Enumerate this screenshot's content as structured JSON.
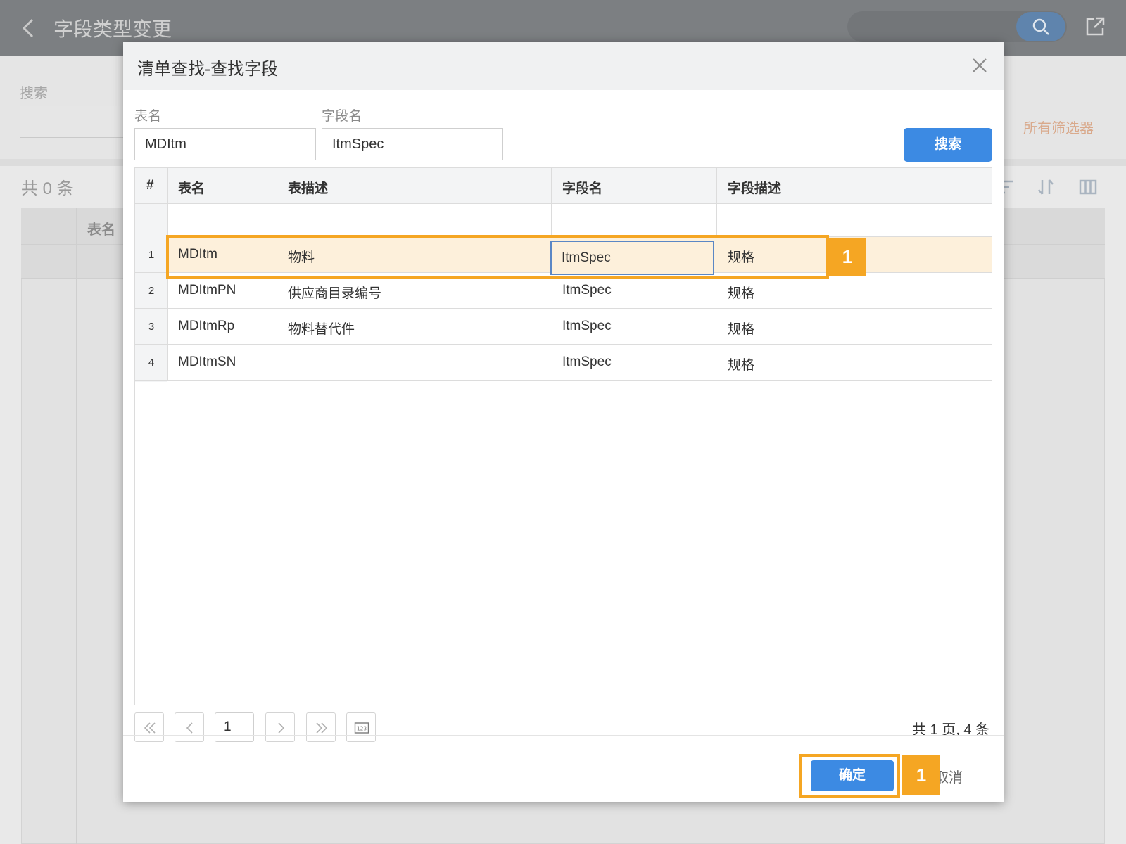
{
  "page": {
    "title": "字段类型变更",
    "search_label": "搜索",
    "all_filters": "所有筛选器",
    "count_label": "共 0 条",
    "table_header_name": "表名"
  },
  "modal": {
    "title": "清单查找-查找字段",
    "filters": {
      "table_label": "表名",
      "table_value": "MDItm",
      "field_label": "字段名",
      "field_value": "ItmSpec",
      "search_button": "搜索"
    },
    "columns": [
      "#",
      "表名",
      "表描述",
      "字段名",
      "字段描述"
    ],
    "rows": [
      {
        "index": "1",
        "table": "MDItm",
        "table_desc": "物料",
        "field": "ItmSpec",
        "field_desc": "规格"
      },
      {
        "index": "2",
        "table": "MDItmPN",
        "table_desc": "供应商目录编号",
        "field": "ItmSpec",
        "field_desc": "规格"
      },
      {
        "index": "3",
        "table": "MDItmRp",
        "table_desc": "物料替代件",
        "field": "ItmSpec",
        "field_desc": "规格"
      },
      {
        "index": "4",
        "table": "MDItmSN",
        "table_desc": "",
        "field": "ItmSpec",
        "field_desc": "规格"
      }
    ],
    "pagination": {
      "current_page": "1",
      "summary": "共 1 页, 4 条"
    },
    "ok_button": "确定",
    "cancel_button": "取消"
  },
  "annotations": {
    "row_badge": "1",
    "ok_badge": "1",
    "color": "#f5a623"
  },
  "colors": {
    "primary": "#3c8ae3",
    "selected_row": "#fdf0db",
    "highlight": "#f5a623"
  }
}
